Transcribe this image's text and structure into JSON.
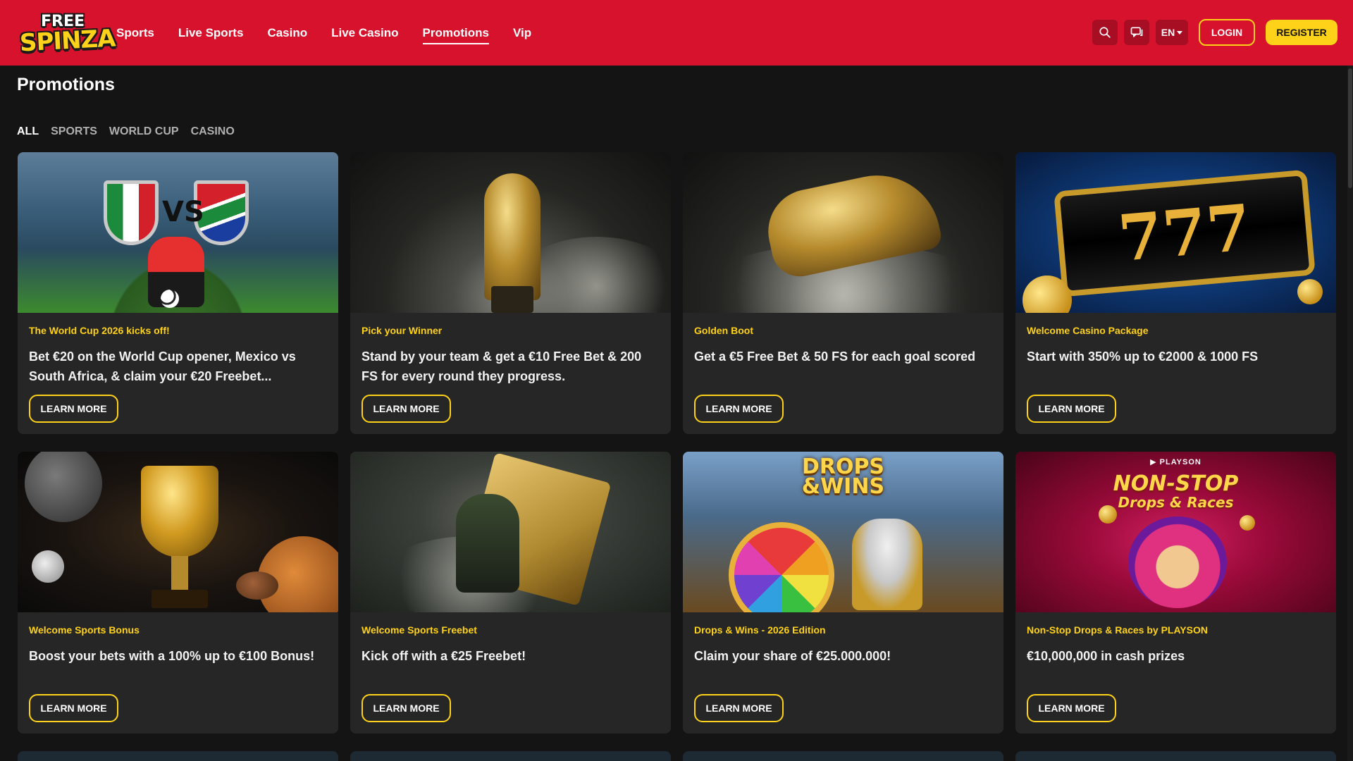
{
  "header": {
    "logo_top": "FREE",
    "logo_bottom": "SPINZA",
    "nav": [
      "Sports",
      "Live Sports",
      "Casino",
      "Live Casino",
      "Promotions",
      "Vip"
    ],
    "active_nav": "Promotions",
    "language": "EN",
    "login_label": "LOGIN",
    "register_label": "REGISTER",
    "accent": "#d6122d",
    "button_color": "#ffd21a"
  },
  "page": {
    "title": "Promotions",
    "filters": [
      "ALL",
      "SPORTS",
      "WORLD CUP",
      "CASINO"
    ],
    "active_filter": "ALL"
  },
  "promotions": [
    {
      "tag": "The World Cup 2026 kicks off!",
      "description": "Bet €20 on the World Cup opener, Mexico vs South Africa, & claim your €20 Freebet...",
      "button": "LEARN MORE",
      "image": "world-cup-opener",
      "image_text": "VS"
    },
    {
      "tag": "Pick your Winner",
      "description": "Stand by your team & get a €10 Free Bet & 200 FS for every round they progress.",
      "button": "LEARN MORE",
      "image": "trophy"
    },
    {
      "tag": "Golden Boot",
      "description": "Get a €5 Free Bet & 50 FS for each goal scored",
      "button": "LEARN MORE",
      "image": "golden-boot"
    },
    {
      "tag": "Welcome Casino Package",
      "description": "Start with 350% up to €2000 & 1000 FS",
      "button": "LEARN MORE",
      "image": "slot-777",
      "image_text": "777"
    },
    {
      "tag": "Welcome Sports Bonus",
      "description": "Boost your bets with a 100% up to €100 Bonus!",
      "button": "LEARN MORE",
      "image": "gold-cup"
    },
    {
      "tag": "Welcome Sports Freebet",
      "description": "Kick off with a €25 Freebet!",
      "button": "LEARN MORE",
      "image": "footballer-ticket"
    },
    {
      "tag": "Drops & Wins - 2026 Edition",
      "description": "Claim your share of €25.000.000!",
      "button": "LEARN MORE",
      "image": "drops-wins",
      "image_title_1": "DROPS",
      "image_title_2": "&WINS"
    },
    {
      "tag": "Non-Stop Drops & Races by PLAYSON",
      "description": "€10,000,000 in cash prizes",
      "button": "LEARN MORE",
      "image": "non-stop",
      "image_brand": "▶ PLAYSON",
      "image_title_1": "NON-STOP",
      "image_title_2": "Drops & Races"
    }
  ]
}
